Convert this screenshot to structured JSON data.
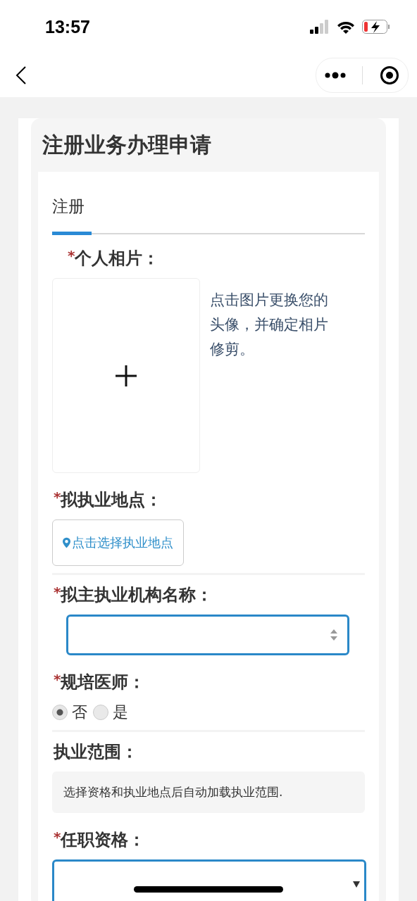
{
  "status_bar": {
    "time": "13:57"
  },
  "page": {
    "title": "注册业务办理申请"
  },
  "tabs": [
    {
      "label": "注册",
      "selected": true
    }
  ],
  "fields": [
    {
      "kind": "photo",
      "required_mark": "*",
      "label": "个人相片：",
      "hint": "点击图片更换您的头像，并确定相片修剪。"
    },
    {
      "kind": "location",
      "required_mark": "*",
      "label": "拟执业地点：",
      "button": "点击选择执业地点"
    },
    {
      "kind": "spinner",
      "required_mark": "*",
      "label": "拟主执业机构名称："
    },
    {
      "kind": "radio",
      "required_mark": "*",
      "label": "规培医师：",
      "options": [
        {
          "label": "否",
          "selected": true
        },
        {
          "label": "是",
          "selected": false
        }
      ]
    },
    {
      "kind": "info",
      "label": "执业范围：",
      "text": "选择资格和执业地点后自动加载执业范围."
    },
    {
      "kind": "dropdown",
      "required_mark": "*",
      "label": "任职资格："
    }
  ]
}
